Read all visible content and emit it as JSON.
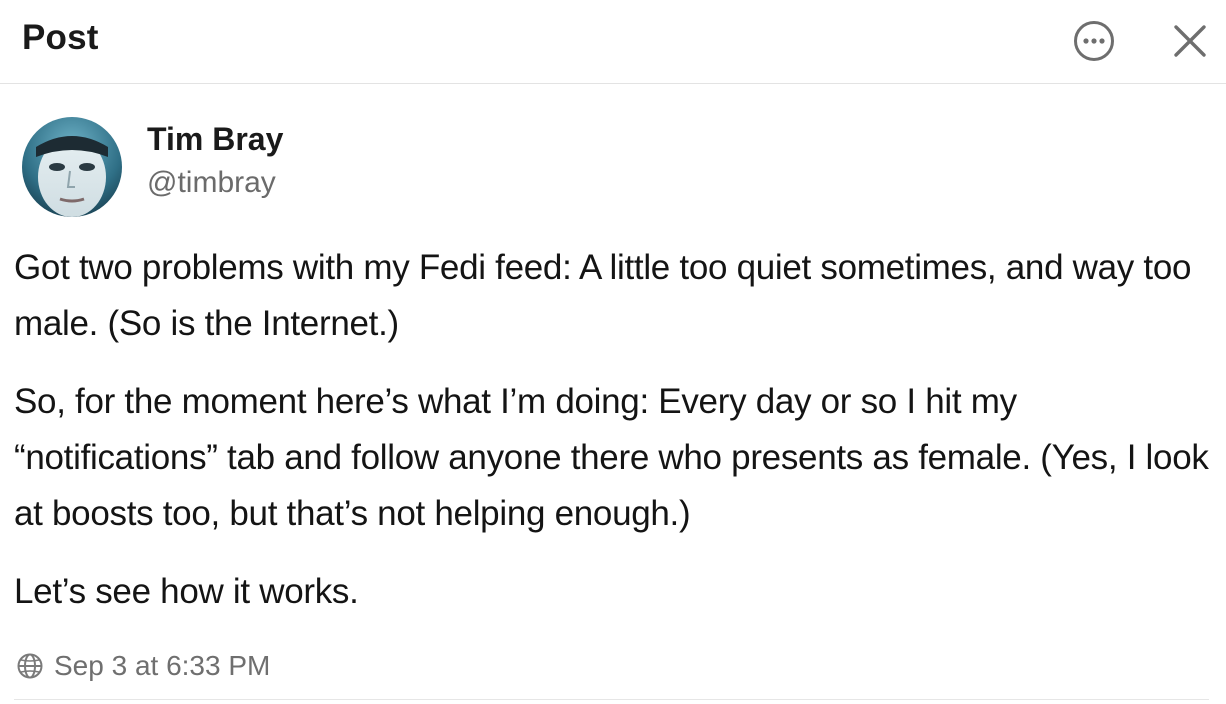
{
  "header": {
    "title": "Post",
    "more_icon": "more-horizontal-circle-icon",
    "close_icon": "close-icon"
  },
  "author": {
    "name": "Tim Bray",
    "handle": "@timbray",
    "avatar_icon": "avatar-photo"
  },
  "post": {
    "paragraphs": [
      "Got two problems with my Fedi feed: A little too quiet sometimes, and way too male. (So is the Internet.)",
      "So, for the moment here’s what I’m doing: Every day or so I hit my “notifications” tab and follow anyone there who presents as female. (Yes, I look at boosts too, but that’s not helping enough.)",
      "Let’s see how it works."
    ],
    "timestamp": "Sep 3 at 6:33 PM",
    "visibility_icon": "globe-icon"
  },
  "colors": {
    "text_primary": "#141414",
    "text_secondary": "#6b6b6b",
    "divider": "#e3e3e3",
    "icon": "#6e6e6e"
  }
}
